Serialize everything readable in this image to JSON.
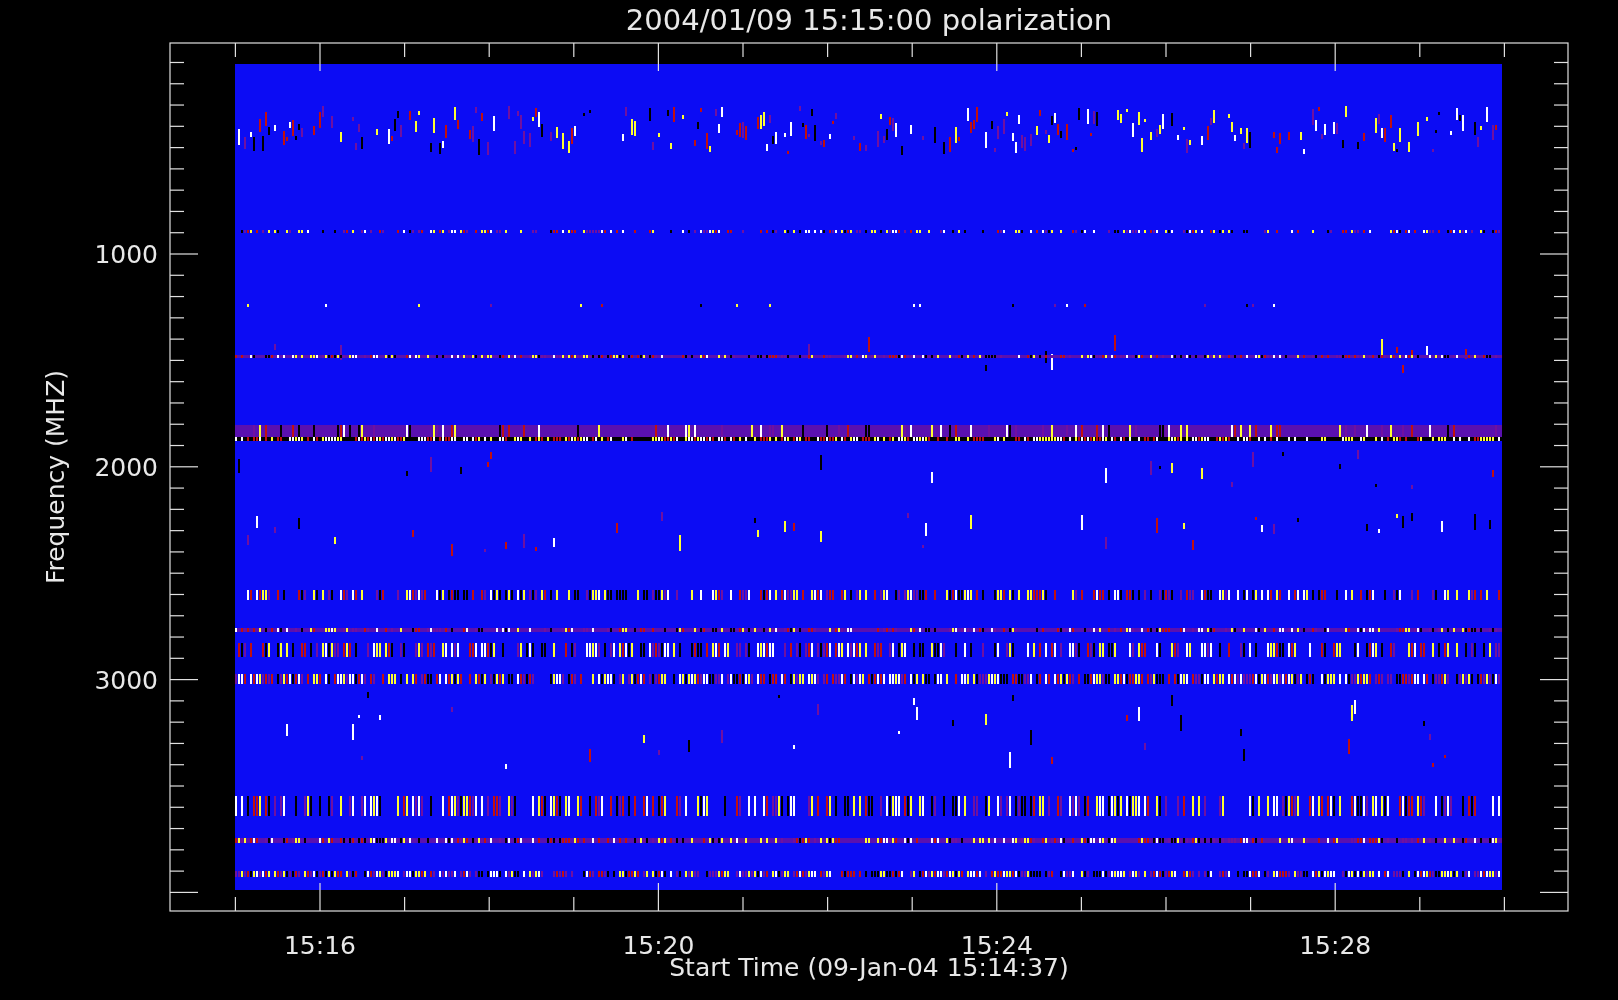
{
  "title": "2004/01/09 15:15:00 polarization",
  "y_axis": {
    "title": "Frequency (MHZ)",
    "tick_labels": [
      "1000",
      "2000",
      "3000"
    ]
  },
  "x_axis": {
    "title": "Start Time (09-Jan-04 15:14:37)",
    "tick_labels": [
      "15:16",
      "15:20",
      "15:24",
      "15:28"
    ]
  }
}
